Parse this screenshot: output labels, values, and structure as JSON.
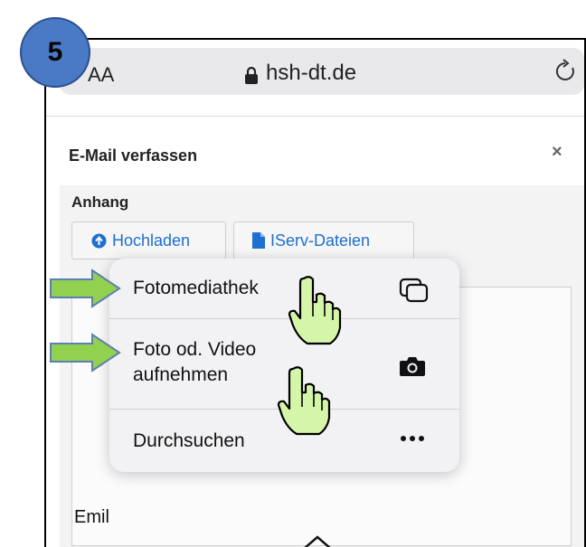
{
  "step_badge": "5",
  "browser": {
    "text_size_button": "AA",
    "domain": "hsh-dt.de",
    "lock_icon": "lock-icon",
    "reload_icon": "reload-icon"
  },
  "modal": {
    "title": "E-Mail verfassen",
    "close_label": "×",
    "attachment_heading": "Anhang",
    "upload_button": "Hochladen",
    "iserv_files_button": "IServ-Dateien",
    "body_text": "Emil"
  },
  "file_picker_menu": {
    "items": [
      {
        "label": "Fotomediathek",
        "icon": "photo-library-icon"
      },
      {
        "label": "Foto od. Video aufnehmen",
        "icon": "camera-icon"
      },
      {
        "label": "Durchsuchen",
        "icon": "more-icon"
      }
    ]
  },
  "annotations": {
    "arrow_color": "#92d050",
    "hand_cursor_color": "#d5f5a8"
  }
}
